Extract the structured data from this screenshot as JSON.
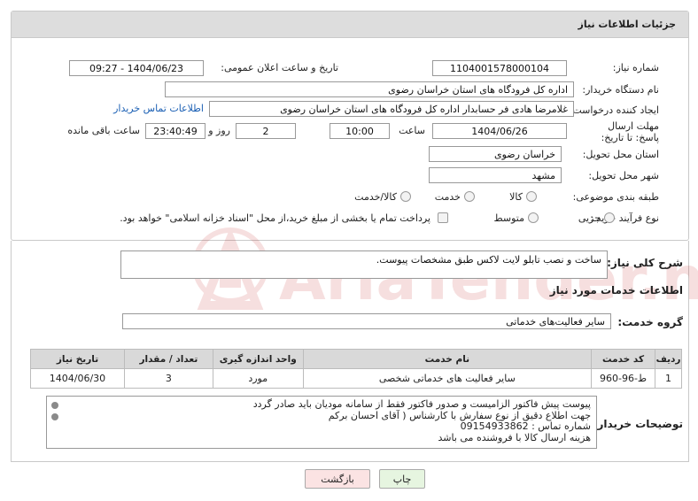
{
  "header": {
    "title": "جزئیات اطلاعات نیاز"
  },
  "fields": {
    "need_number_label": "شماره نیاز:",
    "need_number": "1104001578000104",
    "announce_label": "تاریخ و ساعت اعلان عمومی:",
    "announce_value": "1404/06/23 - 09:27",
    "buyer_org_label": "نام دستگاه خریدار:",
    "buyer_org": "اداره کل فرودگاه های استان خراسان رضوی",
    "requester_label": "ایجاد کننده درخواست:",
    "requester": "غلامرضا هادی فر حسابدار اداره کل فرودگاه های استان خراسان رضوی",
    "buyer_contact_link": "اطلاعات تماس خریدار",
    "deadline_label": "مهلت ارسال پاسخ: تا تاریخ:",
    "deadline_date": "1404/06/26",
    "time_label": "ساعت",
    "deadline_time": "10:00",
    "days_value": "2",
    "days_label": "روز و",
    "remaining_time": "23:40:49",
    "remaining_label": "ساعت باقی مانده",
    "province_label": "استان محل تحویل:",
    "province": "خراسان رضوی",
    "city_label": "شهر محل تحویل:",
    "city": "مشهد",
    "category_label": "طبقه بندی موضوعی:",
    "category_options": [
      "کالا",
      "خدمت",
      "کالا/خدمت"
    ],
    "process_label": "نوع فرآیند خرید :",
    "process_options": [
      "جزیی",
      "متوسط"
    ],
    "payment_note": "پرداخت تمام یا بخشی از مبلغ خرید،از محل \"اسناد خزانه اسلامی\" خواهد بود."
  },
  "summary": {
    "label": "شرح کلی نیاز:",
    "value": "ساخت و نصب تابلو لایت لاکس طبق مشخصات پیوست."
  },
  "services": {
    "section_title": "اطلاعات خدمات مورد نیاز",
    "group_label": "گروه خدمت:",
    "group_value": "سایر فعالیت‌های خدماتی",
    "columns": [
      "ردیف",
      "کد خدمت",
      "نام خدمت",
      "واحد اندازه گیری",
      "تعداد / مقدار",
      "تاریخ نیاز"
    ],
    "rows": [
      [
        "1",
        "ط-96-960",
        "سایر فعالیت های خدماتی شخصی",
        "مورد",
        "3",
        "1404/06/30"
      ]
    ]
  },
  "notes": {
    "label": "توضیحات خریدار:",
    "lines": [
      "پیوست پیش فاکتور الزامیست و صدور فاکتور فقط از سامانه مودیان باید صادر گردد",
      "جهت اطلاع دقیق از نوع سفارش با کارشناس  ( آقای احسان برکم",
      "شماره تماس : 09154933862",
      "هزینه ارسال کالا با فروشنده می باشد"
    ]
  },
  "buttons": {
    "print": "چاپ",
    "back": "بازگشت"
  },
  "watermark": {
    "text": "AriaTender.neT"
  },
  "colors": {
    "header_bg": "#dddddd",
    "link": "#1a5fb4",
    "back_button_bg": "#fbe3e3",
    "print_button_bg": "#e6f5e0",
    "watermark": "#c62828"
  }
}
